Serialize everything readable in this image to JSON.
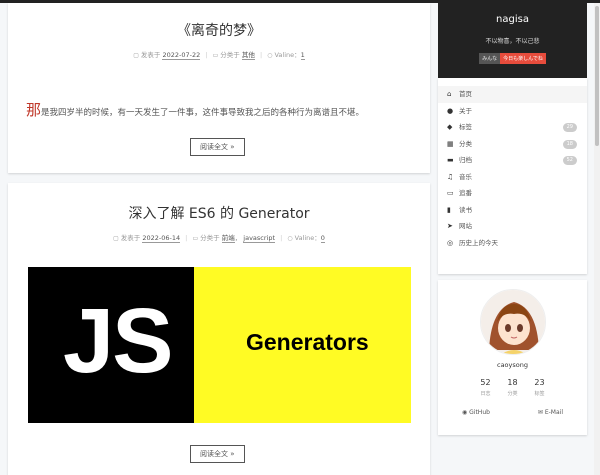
{
  "posts": [
    {
      "title": "《离奇的梦》",
      "meta": {
        "posted_label": "发表于",
        "date": "2022-07-22",
        "category_label": "分类于",
        "category": "其他",
        "comments_label": "Valine：",
        "comments": "1"
      },
      "dropcap": "那",
      "excerpt": "是我四岁半的时候，有一天发生了一件事，这件事导致我之后的各种行为离谱且不堪。",
      "read_more": "阅读全文 »"
    },
    {
      "title": "深入了解 ES6 的 Generator",
      "meta": {
        "posted_label": "发表于",
        "date": "2022-06-14",
        "category_label": "分类于",
        "category": "前端",
        "category2": "javascript",
        "comments_label": "Valine：",
        "comments": "0"
      },
      "banner": {
        "left_text": "JS",
        "right_text": "Generators"
      },
      "read_more": "阅读全文 »"
    }
  ],
  "sidebar": {
    "site_name": "nagisa",
    "subtitle": "不以物喜，不以己悲",
    "tags": [
      "みんな",
      "今日も楽しんでね"
    ],
    "menu": [
      {
        "icon": "home-icon",
        "glyph": "⌂",
        "label": "首页",
        "active": true
      },
      {
        "icon": "user-icon",
        "glyph": "●",
        "label": "关于"
      },
      {
        "icon": "tag-icon",
        "glyph": "◆",
        "label": "标签",
        "badge": "29"
      },
      {
        "icon": "grid-icon",
        "glyph": "▦",
        "label": "分类",
        "badge": "18"
      },
      {
        "icon": "archive-icon",
        "glyph": "▬",
        "label": "归档",
        "badge": "52"
      },
      {
        "icon": "music-icon",
        "glyph": "♫",
        "label": "音乐"
      },
      {
        "icon": "monitor-icon",
        "glyph": "▭",
        "label": "追番"
      },
      {
        "icon": "book-icon",
        "glyph": "▮",
        "label": "读书"
      },
      {
        "icon": "send-icon",
        "glyph": "➤",
        "label": "网站"
      },
      {
        "icon": "history-icon",
        "glyph": "◎",
        "label": "历史上的今天"
      }
    ],
    "author": {
      "name": "caoysong",
      "stats": [
        {
          "num": "52",
          "label": "日志"
        },
        {
          "num": "18",
          "label": "分类"
        },
        {
          "num": "23",
          "label": "标签"
        }
      ],
      "links": [
        {
          "icon": "github-icon",
          "glyph": "◉",
          "label": "GitHub"
        },
        {
          "icon": "email-icon",
          "glyph": "✉",
          "label": "E-Mail"
        }
      ]
    }
  },
  "colors": {
    "accent_red": "#c0392b",
    "banner_yellow": "#fffb24",
    "header_dark": "#222222"
  }
}
